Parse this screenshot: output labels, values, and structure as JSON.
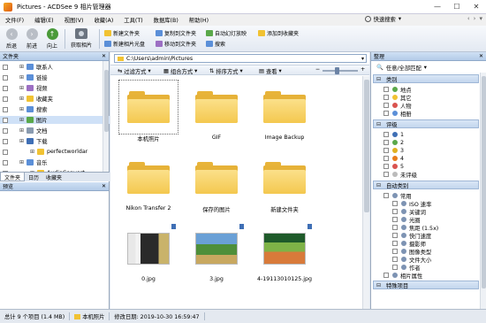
{
  "window": {
    "title": "Pictures - ACDSee 9 相片管理器",
    "minimize": "—",
    "maximize": "☐",
    "close": "✕"
  },
  "menu": {
    "items": [
      "文件(F)",
      "编辑(E)",
      "视图(V)",
      "收藏(A)",
      "工具(T)",
      "数据库(B)",
      "帮助(H)"
    ],
    "quick_search": "快速搜索",
    "quick_search_arrow": "▾",
    "extras": [
      "‹",
      "›",
      "▾"
    ]
  },
  "toolbar": {
    "back": "后退",
    "forward": "前进",
    "up": "向上",
    "get_photos": "获取相片",
    "commands": {
      "new_folder": "新建文件夹",
      "new_album_disc": "新建相片光盘",
      "copy_to_folder": "复制到文件夹",
      "move_to_folder": "移动到文件夹",
      "auto_slideshow": "自动幻灯放映",
      "search": "搜索",
      "add_to_favorites": "添加到收藏夹"
    }
  },
  "left_panel": {
    "header": "文件夹",
    "pin": "✕",
    "tree": [
      {
        "label": "联系人",
        "indent": 1,
        "color": "#5b8fd8"
      },
      {
        "label": "链接",
        "indent": 1,
        "color": "#5b8fd8"
      },
      {
        "label": "视频",
        "indent": 1,
        "color": "#9c6fc3"
      },
      {
        "label": "收藏夹",
        "indent": 1,
        "color": "#f1c232"
      },
      {
        "label": "搜索",
        "indent": 1,
        "color": "#5b8fd8"
      },
      {
        "label": "图片",
        "indent": 1,
        "color": "#5aa84a",
        "selected": true
      },
      {
        "label": "文档",
        "indent": 1,
        "color": "#8a9bb0"
      },
      {
        "label": "下载",
        "indent": 1,
        "color": "#3f6fb5"
      },
      {
        "label": "perfectworldar",
        "indent": 2,
        "color": "#f1c232"
      },
      {
        "label": "音乐",
        "indent": 1,
        "color": "#5b8fd8"
      },
      {
        "label": "AudioConvert",
        "indent": 2,
        "color": "#f1c232"
      }
    ],
    "tabs": [
      "文件夹",
      "日历",
      "收藏夹"
    ],
    "preview_header": "预览"
  },
  "center": {
    "address": "C:\\Users\\admin\\Pictures",
    "filter_label": "过滤方式",
    "group_label": "组合方式",
    "sort_label": "排序方式",
    "view_label": "查看",
    "zoom_minus": "−",
    "zoom_plus": "+",
    "items": [
      {
        "name": "本机照片",
        "kind": "folder",
        "selected": true
      },
      {
        "name": "GIF",
        "kind": "folder"
      },
      {
        "name": "Image Backup",
        "kind": "folder"
      },
      {
        "name": "Nikon Transfer 2",
        "kind": "folder"
      },
      {
        "name": "保存的图片",
        "kind": "folder"
      },
      {
        "name": "新建文件夹",
        "kind": "folder"
      },
      {
        "name": "0.jpg",
        "kind": "image"
      },
      {
        "name": "3.jpg",
        "kind": "image"
      },
      {
        "name": "4-19113010125.jpg",
        "kind": "image"
      }
    ]
  },
  "right_panel": {
    "header": "整理",
    "pin": "✕",
    "mode": "任意/全部匹配",
    "categories_title": "类别",
    "categories": [
      {
        "label": "地点",
        "color": "#5aa84a"
      },
      {
        "label": "其它",
        "color": "#f1c232"
      },
      {
        "label": "人物",
        "color": "#d9534f"
      },
      {
        "label": "相册",
        "color": "#5b8fd8"
      }
    ],
    "rating_title": "评级",
    "ratings": [
      {
        "label": "1",
        "color": "#3f6fb5"
      },
      {
        "label": "2",
        "color": "#5aa84a"
      },
      {
        "label": "3",
        "color": "#e0b020"
      },
      {
        "label": "4",
        "color": "#e87c1a"
      },
      {
        "label": "5",
        "color": "#d9534f"
      },
      {
        "label": "未评级",
        "color": "#bbbbbb"
      }
    ],
    "auto_title": "自动类别",
    "auto_items": [
      {
        "label": "常用",
        "indent": 0
      },
      {
        "label": "ISO 速率",
        "indent": 1
      },
      {
        "label": "关键词",
        "indent": 1
      },
      {
        "label": "光圈",
        "indent": 1
      },
      {
        "label": "焦距 (1.5x)",
        "indent": 1
      },
      {
        "label": "快门速度",
        "indent": 1
      },
      {
        "label": "摄影师",
        "indent": 1
      },
      {
        "label": "图像类型",
        "indent": 1
      },
      {
        "label": "文件大小",
        "indent": 1
      },
      {
        "label": "作者",
        "indent": 1
      },
      {
        "label": "相片属性",
        "indent": 0
      }
    ],
    "special_title": "特殊项目"
  },
  "status": {
    "count": "总计 9 个项目 (1.4 MB)",
    "location": "本机照片",
    "modified": "修改日期: 2019-10-30 16:59:47"
  },
  "colors": {
    "accent": "#3f6fb5",
    "folder": "#f4c84f"
  }
}
